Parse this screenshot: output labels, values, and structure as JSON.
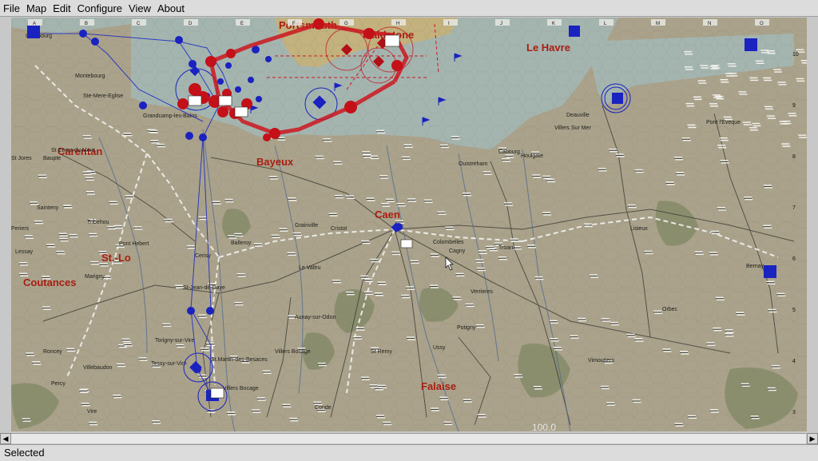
{
  "menu": [
    "File",
    "Map",
    "Edit",
    "Configure",
    "View",
    "About"
  ],
  "status": "Selected",
  "zoom": "100.0",
  "columns": [
    "A",
    "B",
    "C",
    "D",
    "E",
    "F",
    "G",
    "H",
    "I",
    "J",
    "K",
    "L",
    "M",
    "N",
    "O"
  ],
  "rows": [
    "10",
    "9",
    "8",
    "7",
    "6",
    "5",
    "4",
    "3"
  ],
  "cities": [
    {
      "name": "Portsmouth",
      "big": true
    },
    {
      "name": "Maidstone",
      "big": true
    },
    {
      "name": "Le Havre",
      "big": true
    },
    {
      "name": "Carentan",
      "big": true
    },
    {
      "name": "Bayeux",
      "big": true
    },
    {
      "name": "Caen",
      "big": true
    },
    {
      "name": "St.-Lo",
      "big": true
    },
    {
      "name": "Coutances",
      "big": true
    },
    {
      "name": "Falaise",
      "big": true
    },
    {
      "name": "Cherbourg",
      "big": false
    },
    {
      "name": "Deauville",
      "big": false
    },
    {
      "name": "Pont l'Eveque",
      "big": false
    },
    {
      "name": "Houlgate",
      "big": false
    },
    {
      "name": "Lisieux",
      "big": false
    },
    {
      "name": "Bernay",
      "big": false
    },
    {
      "name": "Vimoutiers",
      "big": false
    },
    {
      "name": "Orbec",
      "big": false
    },
    {
      "name": "Conde",
      "big": false
    },
    {
      "name": "Vire",
      "big": false
    },
    {
      "name": "Ussy",
      "big": false
    },
    {
      "name": "Potigny",
      "big": false
    },
    {
      "name": "Verrieres",
      "big": false
    },
    {
      "name": "Villers Bocage",
      "big": false
    },
    {
      "name": "Aunay-sur-Odon",
      "big": false
    },
    {
      "name": "Torigny-sur-Vire",
      "big": false
    },
    {
      "name": "St.Martin-des-Besaces",
      "big": false
    },
    {
      "name": "Tessy-sur-Vire",
      "big": false
    },
    {
      "name": "Villebaudon",
      "big": false
    },
    {
      "name": "Percy",
      "big": false
    },
    {
      "name": "Roncey",
      "big": false
    },
    {
      "name": "Marigny",
      "big": false
    },
    {
      "name": "St-Jean-de-Daye",
      "big": false
    },
    {
      "name": "Pont Hebert",
      "big": false
    },
    {
      "name": "Tribehou",
      "big": false
    },
    {
      "name": "Lessay",
      "big": false
    },
    {
      "name": "Periers",
      "big": false
    },
    {
      "name": "Sainteny",
      "big": false
    },
    {
      "name": "St Jores",
      "big": false
    },
    {
      "name": "Baupte",
      "big": false
    },
    {
      "name": "St Come du Mont",
      "big": false
    },
    {
      "name": "Villers Bocage",
      "big": false
    },
    {
      "name": "Grainville",
      "big": false
    },
    {
      "name": "Le Valtru",
      "big": false
    },
    {
      "name": "Cristot",
      "big": false
    },
    {
      "name": "Balleroy",
      "big": false
    },
    {
      "name": "Cerisy",
      "big": false
    },
    {
      "name": "St Remy",
      "big": false
    },
    {
      "name": "Cagny",
      "big": false
    },
    {
      "name": "Troarn",
      "big": false
    },
    {
      "name": "Colombelles",
      "big": false
    },
    {
      "name": "Ouistreham",
      "big": false
    },
    {
      "name": "Cabourg",
      "big": false
    },
    {
      "name": "Villers Sur Mer",
      "big": false
    },
    {
      "name": "Montebourg",
      "big": false
    },
    {
      "name": "Ste-Mere-Eglise",
      "big": false
    },
    {
      "name": "Grandcamp-les-Bains",
      "big": false
    }
  ],
  "colors": {
    "allied": "#1020c8",
    "axis": "#c8101a",
    "land": "#a9a08a",
    "sea": "#9fb1ac",
    "city": "#a81e12"
  }
}
